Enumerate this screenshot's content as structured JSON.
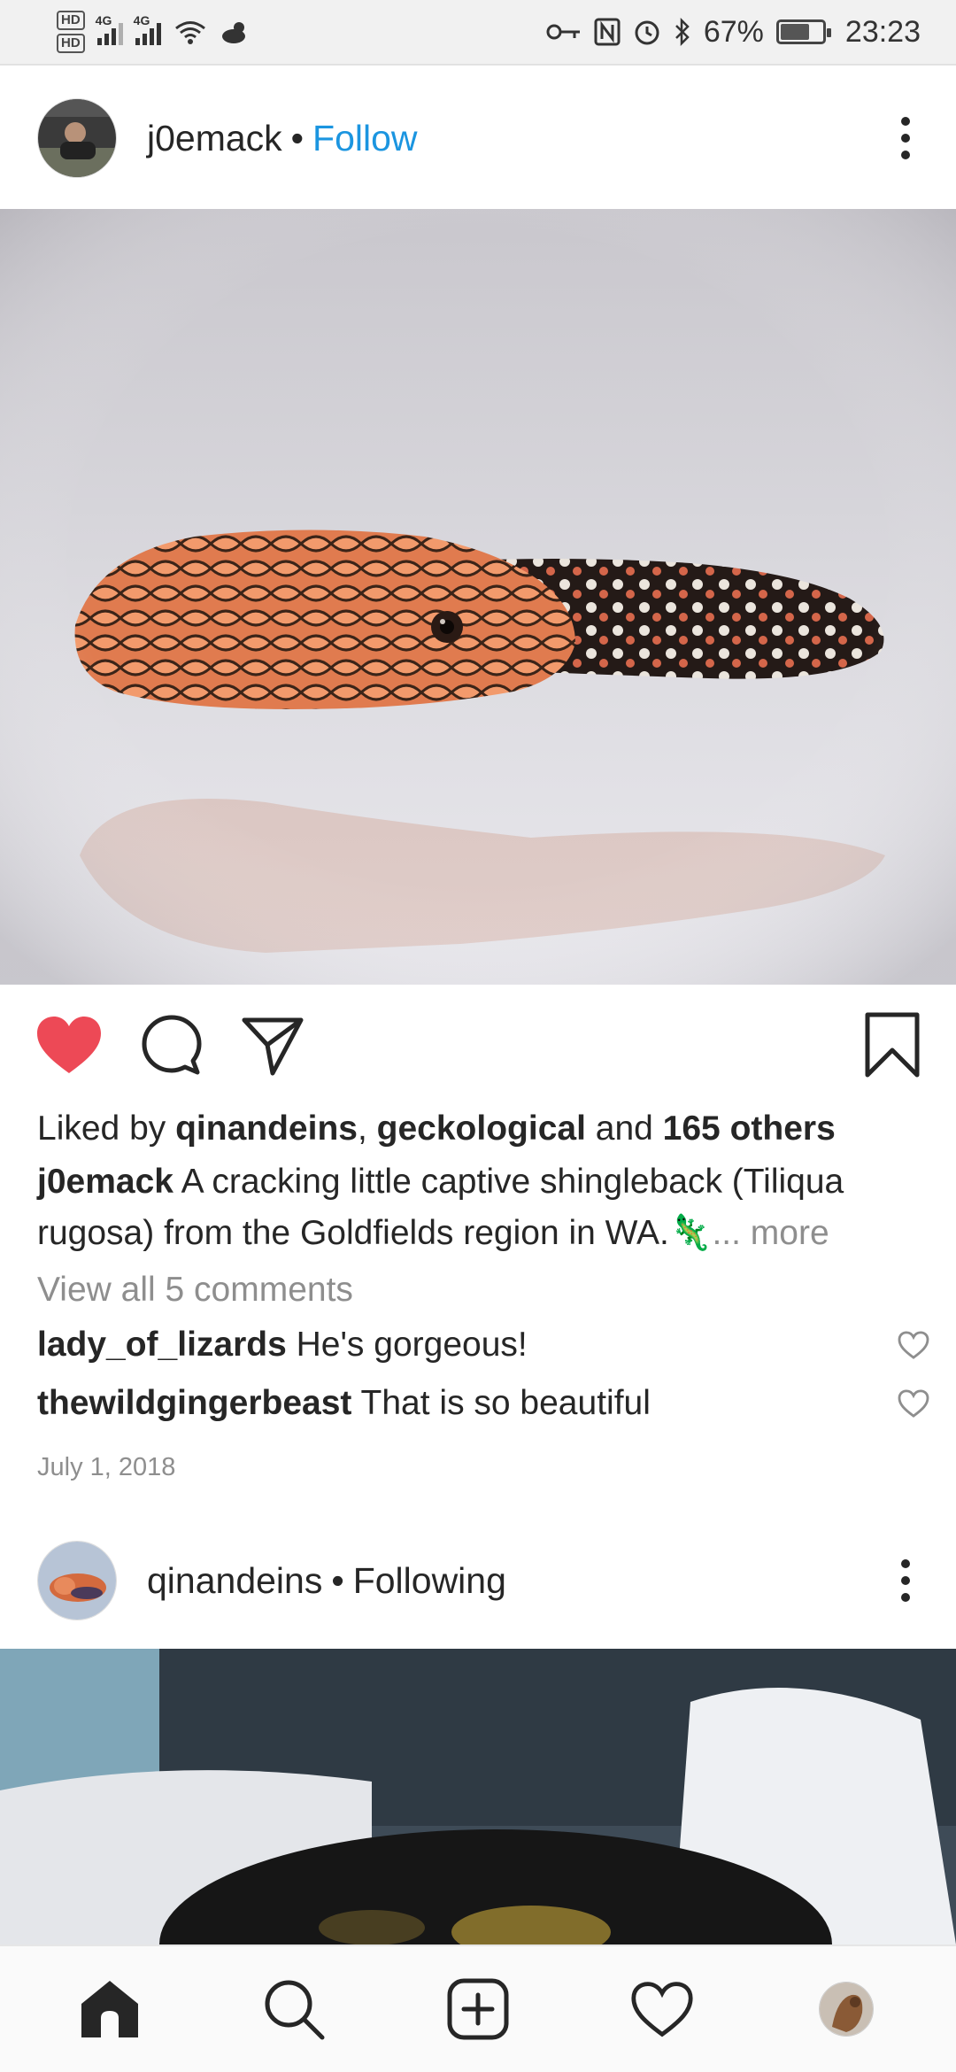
{
  "status_bar": {
    "hd1": "HD",
    "hd2": "HD",
    "net1": "4G",
    "net2": "4G",
    "battery": "67%",
    "battery_level": 0.67,
    "time": "23:23",
    "icons": [
      "key-icon",
      "nfc-icon",
      "alarm-icon",
      "bluetooth-icon",
      "wifi-icon",
      "weather-icon"
    ]
  },
  "post1": {
    "username": "j0emack",
    "separator": "•",
    "follow_label": "Follow",
    "likes_prefix": "Liked by",
    "liker1": "qinandeins",
    "liker_sep": ",",
    "liker2": "geckological",
    "likes_and": "and",
    "likes_others": "165 others",
    "caption_user": "j0emack",
    "caption_text": "A cracking little captive shingleback (Tiliqua rugosa) from the Goldfields region in WA.",
    "caption_emoji": "🦎",
    "more_label": "... more",
    "view_comments": "View all 5 comments",
    "comments": [
      {
        "user": "lady_of_lizards",
        "text": "He's gorgeous!"
      },
      {
        "user": "thewildgingerbeast",
        "text": "That is so beautiful"
      }
    ],
    "date": "July 1, 2018",
    "liked": true
  },
  "post2": {
    "username": "qinandeins",
    "separator": "•",
    "status_label": "Following"
  },
  "bottom_nav": {
    "items": [
      "home-icon",
      "search-icon",
      "new-post-icon",
      "activity-heart-icon",
      "profile-avatar"
    ]
  },
  "colors": {
    "like_red": "#ed4956",
    "link_blue": "#1b95e0",
    "text": "#262626",
    "muted": "#8e8e8e"
  }
}
